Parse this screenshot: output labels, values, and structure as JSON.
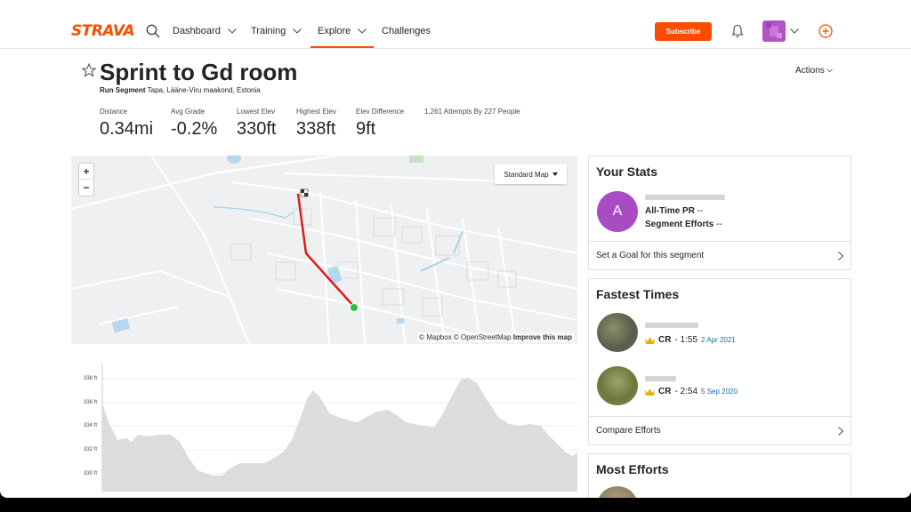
{
  "brand": {
    "name": "STRAVA",
    "accent": "#fc4c02"
  },
  "nav": {
    "items": [
      {
        "label": "Dashboard",
        "has_dropdown": true
      },
      {
        "label": "Training",
        "has_dropdown": true
      },
      {
        "label": "Explore",
        "has_dropdown": true,
        "active": true
      },
      {
        "label": "Challenges",
        "has_dropdown": false
      }
    ],
    "subscribe_label": "Subscribe"
  },
  "segment": {
    "title": "Sprint to Gd room",
    "type_label": "Run Segment",
    "location": "Tapa, Lääne-Viru maakond, Estonia",
    "actions_label": "Actions",
    "stats": [
      {
        "label": "Distance",
        "value": "0.34mi"
      },
      {
        "label": "Avg Grade",
        "value": "-0.2%"
      },
      {
        "label": "Lowest Elev",
        "value": "330ft"
      },
      {
        "label": "Highest Elev",
        "value": "338ft"
      },
      {
        "label": "Elev Difference",
        "value": "9ft"
      }
    ],
    "attempts": "1,261 Attempts By 227 People"
  },
  "map": {
    "zoom_in": "+",
    "zoom_out": "−",
    "map_type": "Standard Map",
    "attribution_prefix": "© Mapbox © OpenStreetMap",
    "improve_link": "Improve this map",
    "route_color": "#e01b1b",
    "start_color": "#2cbf36"
  },
  "elevation": {
    "y_labels": [
      "338 ft",
      "336 ft",
      "334 ft",
      "332 ft",
      "330 ft"
    ]
  },
  "your_stats": {
    "title": "Your Stats",
    "avatar_letter": "A",
    "pr_label": "All-Time PR",
    "pr_value": "--",
    "efforts_label": "Segment Efforts",
    "efforts_value": "--",
    "goal_link": "Set a Goal for this segment"
  },
  "fastest_times": {
    "title": "Fastest Times",
    "entries": [
      {
        "rank": "CR",
        "time": "- 1:55",
        "date": "2 Apr 2021"
      },
      {
        "rank": "CR",
        "time": "- 2:54",
        "date": "5 Sep 2020"
      }
    ],
    "compare_link": "Compare Efforts"
  },
  "most_efforts": {
    "title": "Most Efforts"
  }
}
